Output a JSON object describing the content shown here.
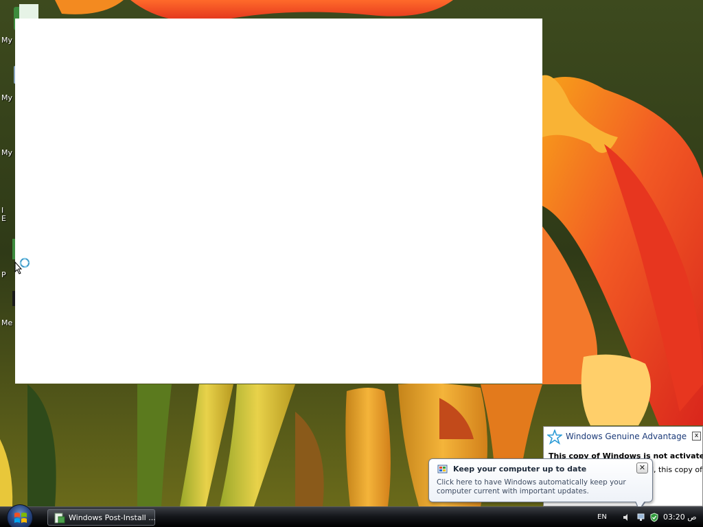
{
  "desktop": {
    "icons": [
      {
        "label": "My D",
        "icon": "documents-icon"
      },
      {
        "label": "My",
        "icon": "computer-icon"
      },
      {
        "label": "My",
        "icon": "network-icon"
      },
      {
        "label": "I",
        "label2": "E",
        "icon": "internet-explorer-icon"
      },
      {
        "label": "P",
        "icon": "program-icon"
      },
      {
        "label": "Me",
        "icon": "media-icon"
      }
    ]
  },
  "wga_balloon": {
    "title": "Windows Genuine Advantage",
    "close_label": "x",
    "message": "This copy of Windows is not activated.",
    "message2": "d, this copy of"
  },
  "update_balloon": {
    "title": "Keep your computer up to date",
    "close_label": "✕",
    "body": "Click here to have Windows automatically keep your computer current with important updates."
  },
  "taskbar": {
    "task_button_label": "Windows Post-Install ...",
    "language": "EN",
    "clock": "03:20 ص"
  },
  "colors": {
    "taskbar": "#15171b",
    "wga_title": "#1b3a78",
    "update_title": "#1e2a3a"
  }
}
